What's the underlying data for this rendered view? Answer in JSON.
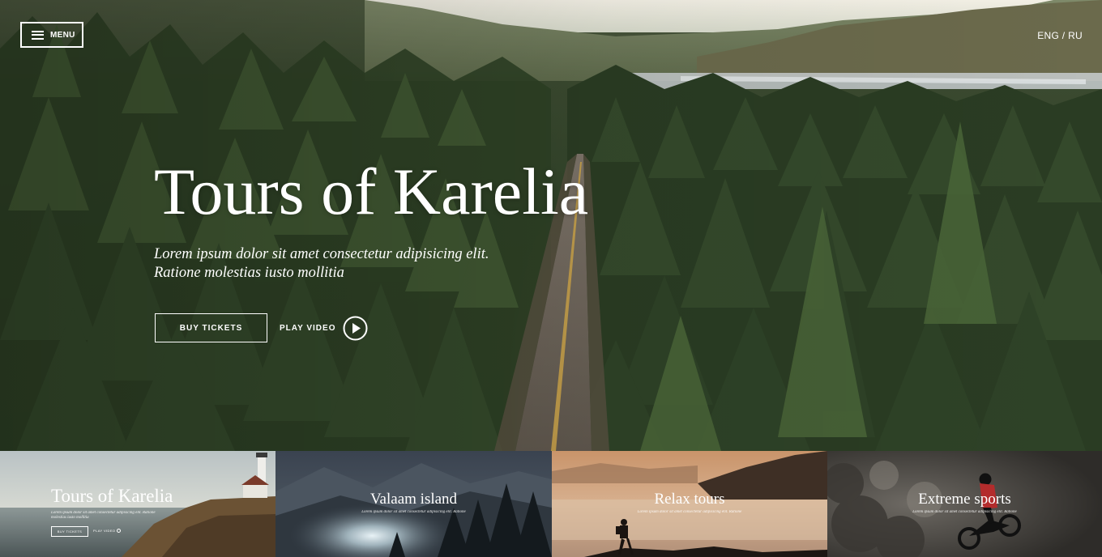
{
  "header": {
    "menu_label": "MENU",
    "lang": {
      "eng": "ENG",
      "separator": " / ",
      "ru": "RU"
    }
  },
  "hero": {
    "title": "Tours of Karelia",
    "subtitle_line1": "Lorem ipsum dolor sit amet consectetur adipisicing elit.",
    "subtitle_line2": "Ratione molestias iusto mollitia",
    "buy_label": "BUY TICKETS",
    "play_label": "PLAY VIDEO",
    "icons": {
      "menu": "hamburger-icon",
      "play": "play-circle-icon"
    }
  },
  "cards": [
    {
      "title": "Tours of Karelia",
      "subtitle_line1": "Lorem ipsum dolor sit amet consectetur adipisicing elit. Ratione",
      "subtitle_line2": "molestias iusto mollitia",
      "buy_label": "BUY TICKETS",
      "play_label": "PLAY VIDEO"
    },
    {
      "title": "Valaam island",
      "subtitle_line1": "Lorem ipsum dolor sit amet consectetur adipisicing elit. Ratione"
    },
    {
      "title": "Relax tours",
      "subtitle_line1": "Lorem ipsum dolor sit amet consectetur adipisicing elit. Ratione"
    },
    {
      "title": "Extreme sports",
      "subtitle_line1": "Lorem ipsum dolor sit amet consectetur adipisicing elit. Ratione"
    }
  ],
  "colors": {
    "forest_dark": "#22301d",
    "forest_mid": "#33452b",
    "road": "#6b6357",
    "road_line": "#c9a24a",
    "text": "#ffffff"
  }
}
